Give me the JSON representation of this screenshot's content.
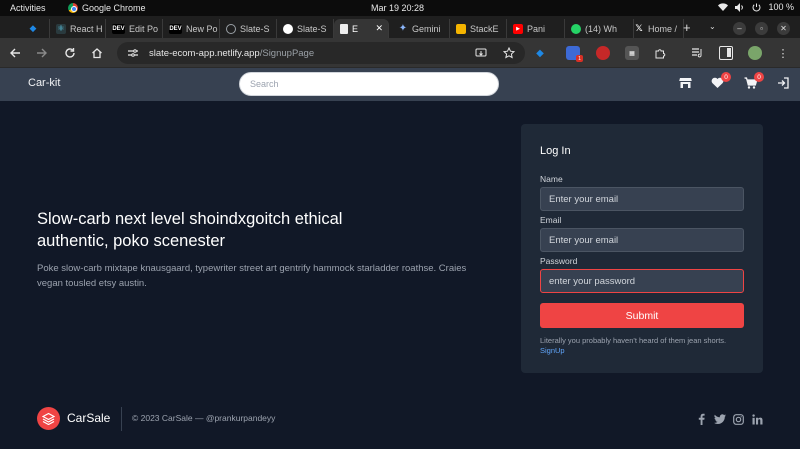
{
  "system_bar": {
    "activities": "Activities",
    "app_name": "Google Chrome",
    "clock": "Mar 19  20:28",
    "battery": "100 %"
  },
  "tabs": [
    {
      "label": "",
      "icon": "gem-icon",
      "color": "#1e88e5"
    },
    {
      "label": "React H",
      "icon": "react-icon",
      "color": "#61dafb"
    },
    {
      "label": "Edit Po",
      "icon": "dev-icon",
      "color": "#000000"
    },
    {
      "label": "New Po",
      "icon": "dev-icon",
      "color": "#000000"
    },
    {
      "label": "Slate-S",
      "icon": "globe-icon",
      "color": "#9aa0a6"
    },
    {
      "label": "Slate-S",
      "icon": "github-icon",
      "color": "#ffffff"
    },
    {
      "label": "E",
      "icon": "page-icon",
      "color": "#ffffff"
    },
    {
      "label": "Gemini",
      "icon": "gemini-icon",
      "color": "#8ab4f8"
    },
    {
      "label": "StackE",
      "icon": "stackexchange-icon",
      "color": "#f4b400"
    },
    {
      "label": "Pani",
      "icon": "youtube-icon",
      "color": "#ff0000"
    },
    {
      "label": "(14) Wh",
      "icon": "whatsapp-icon",
      "color": "#25d366"
    },
    {
      "label": "Home /",
      "icon": "x-icon",
      "color": "#ffffff"
    }
  ],
  "address_bar": {
    "host": "slate-ecom-app.netlify.app",
    "path": "/SignupPage"
  },
  "site": {
    "brand": "Car-kit",
    "search_placeholder": "Search",
    "wishlist_count": "0",
    "cart_count": "0"
  },
  "hero": {
    "title": "Slow-carb next level shoindxgoitch ethical authentic, poko scenester",
    "text": "Poke slow-carb mixtape knausgaard, typewriter street art gentrify hammock starladder roathse. Craies vegan tousled etsy austin."
  },
  "login": {
    "title": "Log In",
    "name_label": "Name",
    "name_placeholder": "Enter your email",
    "email_label": "Email",
    "email_placeholder": "Enter your email",
    "password_label": "Password",
    "password_placeholder": "enter your password",
    "submit": "Submit",
    "note": "Literally you probably haven't heard of them jean shorts.",
    "signup_link": "SignUp"
  },
  "footer": {
    "brand": "CarSale",
    "copyright": "© 2023 CarSale — @prankurpandeyy"
  },
  "colors": {
    "accent": "#ef4444",
    "page_bg": "#111827",
    "header_bg": "#374151",
    "card_bg": "#1f2937",
    "link": "#60a5fa"
  }
}
